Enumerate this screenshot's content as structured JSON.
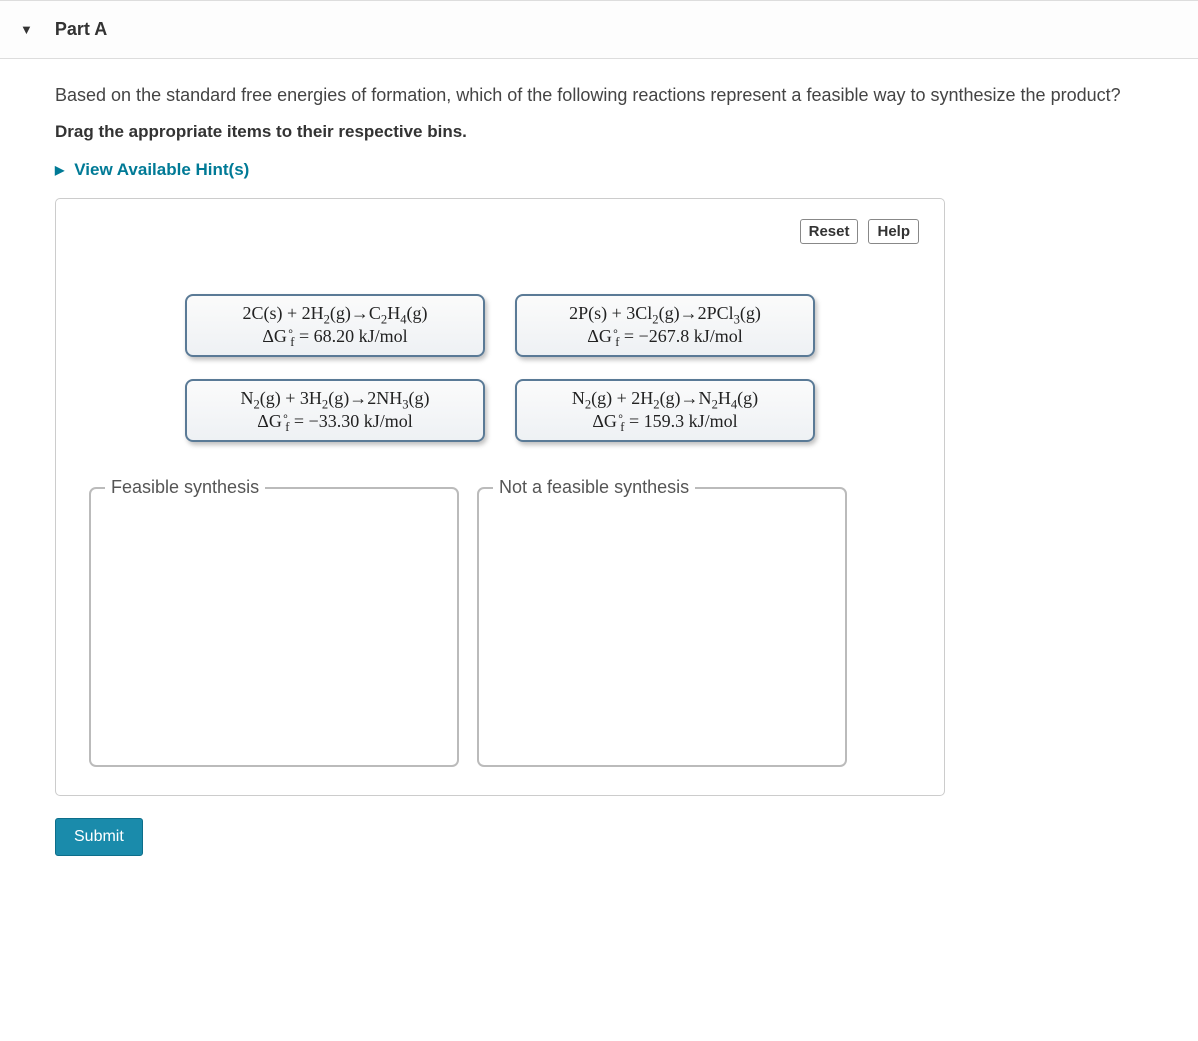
{
  "header": {
    "part_label": "Part A"
  },
  "question": "Based on the standard free energies of formation, which of the following reactions represent a feasible way to synthesize the product?",
  "instruction": "Drag the appropriate items to their respective bins.",
  "hints_label": "View Available Hint(s)",
  "panel": {
    "reset_label": "Reset",
    "help_label": "Help"
  },
  "tiles": {
    "r1": {
      "eq_lhs": "2C(s) + 2H",
      "eq_sub1": "2",
      "eq_mid": "(g)→C",
      "eq_sub2": "2",
      "eq_mid2": "H",
      "eq_sub3": "4",
      "eq_rhs": "(g)",
      "dg_value": "68.20 kJ/mol"
    },
    "r2": {
      "eq_lhs": "2P(s) + 3Cl",
      "eq_sub1": "2",
      "eq_mid": "(g)→2PCl",
      "eq_sub2": "3",
      "eq_rhs": "(g)",
      "dg_value": "−267.8 kJ/mol"
    },
    "r3": {
      "eq_lhs": "N",
      "eq_sub0": "2",
      "eq_mid0": "(g) + 3H",
      "eq_sub1": "2",
      "eq_mid": "(g)→2NH",
      "eq_sub2": "3",
      "eq_rhs": "(g)",
      "dg_value": "−33.30 kJ/mol"
    },
    "r4": {
      "eq_lhs": "N",
      "eq_sub0": "2",
      "eq_mid0": "(g) + 2H",
      "eq_sub1": "2",
      "eq_mid": "(g)→N",
      "eq_sub2": "2",
      "eq_mid2": "H",
      "eq_sub3": "4",
      "eq_rhs": "(g)",
      "dg_value": "159.3 kJ/mol"
    }
  },
  "bins": {
    "feasible": "Feasible synthesis",
    "not_feasible": "Not a feasible synthesis"
  },
  "submit_label": "Submit",
  "dgf_label_html": "ΔG"
}
